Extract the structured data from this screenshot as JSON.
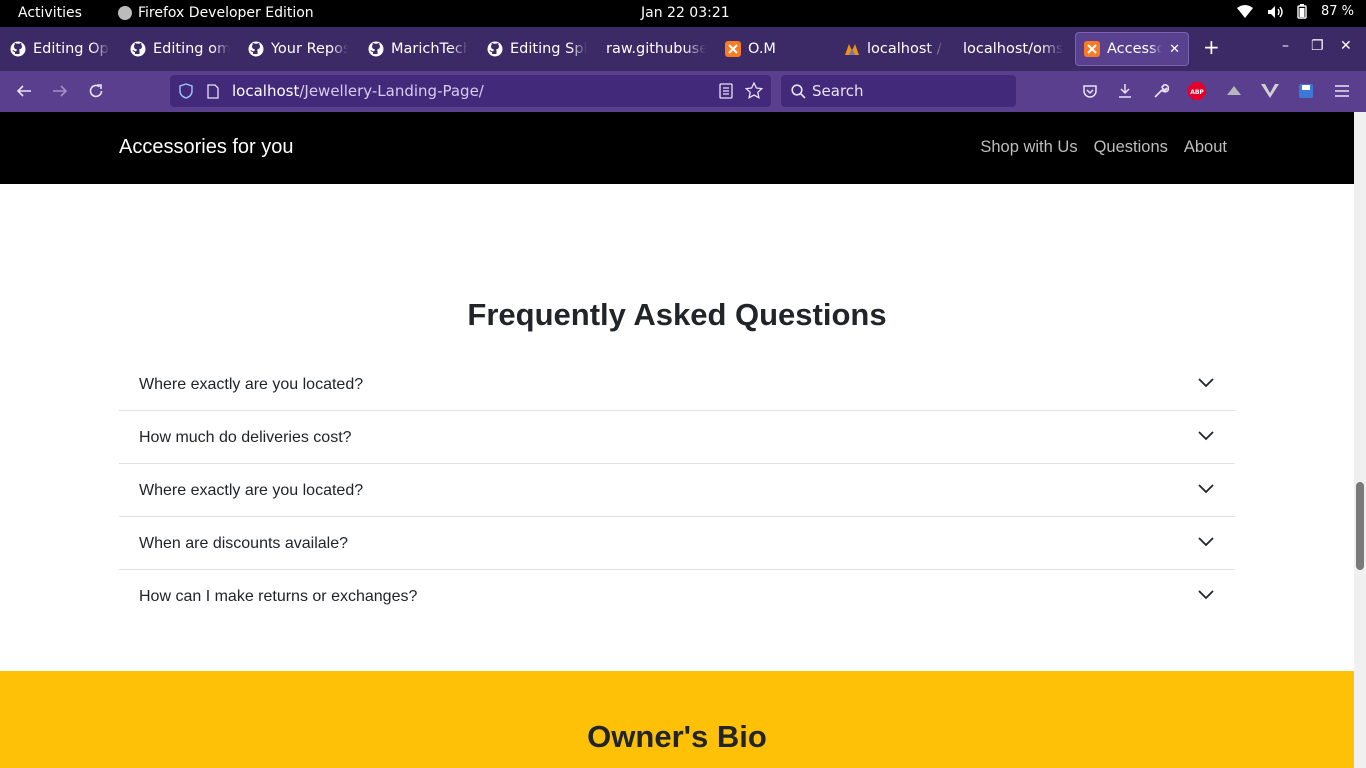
{
  "os_bar": {
    "activities": "Activities",
    "app_name": "Firefox Developer Edition",
    "clock": "Jan 22  03:21",
    "battery": "87 %"
  },
  "tabs": [
    {
      "label": "Editing Opp",
      "icon": "github-icon"
    },
    {
      "label": "Editing oms",
      "icon": "github-icon"
    },
    {
      "label": "Your Repos",
      "icon": "github-icon"
    },
    {
      "label": "MarichTech",
      "icon": "github-icon"
    },
    {
      "label": "Editing Spla",
      "icon": "github-icon"
    },
    {
      "label": "raw.githubuser",
      "icon": ""
    },
    {
      "label": "O.M",
      "icon": "xampp-icon"
    },
    {
      "label": "localhost / l",
      "icon": "phpmyadmin-icon"
    },
    {
      "label": "localhost/oms_",
      "icon": ""
    },
    {
      "label": "Accessori",
      "icon": "xampp-icon",
      "active": true
    }
  ],
  "address": {
    "host": "localhost",
    "path": "/Jewellery-Landing-Page/"
  },
  "search": {
    "placeholder": "Search"
  },
  "site": {
    "brand": "Accessories for you",
    "nav_links": [
      "Shop with Us",
      "Questions",
      "About"
    ]
  },
  "faq": {
    "title": "Frequently Asked Questions",
    "items": [
      "Where exactly are you located?",
      "How much do deliveries cost?",
      "Where exactly are you located?",
      "When are discounts availale?",
      "How can I make returns or exchanges?"
    ]
  },
  "bio": {
    "title": "Owner's Bio"
  },
  "colors": {
    "os_bar": "#000000",
    "tab_strip": "#3b2a66",
    "toolbar": "#5b3f8f",
    "site_nav": "#000000",
    "bio_band": "#ffc107"
  }
}
